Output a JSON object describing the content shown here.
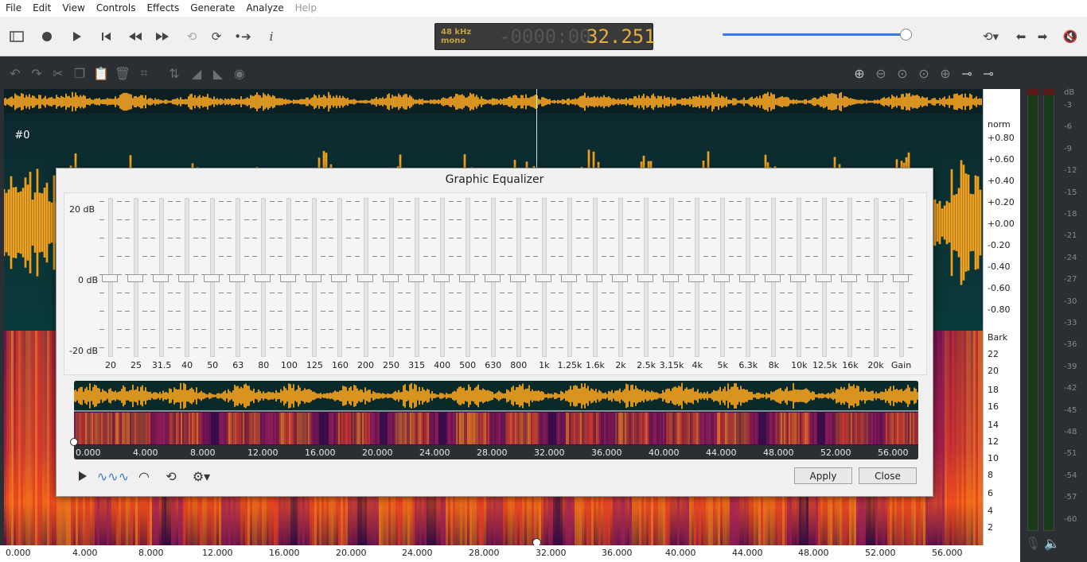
{
  "menu": [
    "File",
    "Edit",
    "View",
    "Controls",
    "Effects",
    "Generate",
    "Analyze",
    "Help"
  ],
  "time_display": {
    "rate": "48 kHz",
    "channels": "mono",
    "dim": "-0000:00",
    "value": "32.251"
  },
  "track": {
    "label": "#0"
  },
  "right_axis": {
    "norm_label": "norm",
    "norm_ticks": [
      "+0.80",
      "+0.60",
      "+0.40",
      "+0.20",
      "+0.00",
      "-0.20",
      "-0.40",
      "-0.60",
      "-0.80"
    ],
    "bark_label": "Bark",
    "bark_ticks": [
      "22",
      "20",
      "18",
      "16",
      "14",
      "12",
      "10",
      "8",
      "6",
      "4",
      "2"
    ]
  },
  "bottom_ruler": [
    "0.000",
    "4.000",
    "8.000",
    "12.000",
    "16.000",
    "20.000",
    "24.000",
    "28.000",
    "32.000",
    "36.000",
    "40.000",
    "44.000",
    "48.000",
    "52.000",
    "56.000"
  ],
  "meters": {
    "unit": "dB",
    "ticks": [
      "-3",
      "-6",
      "-9",
      "-12",
      "-15",
      "-18",
      "-21",
      "-24",
      "-27",
      "-30",
      "-33",
      "-36",
      "-39",
      "-42",
      "-45",
      "-48",
      "-51",
      "-54",
      "-57",
      "-60"
    ]
  },
  "dialog": {
    "title": "Graphic Equalizer",
    "db_labels": [
      "20 dB",
      "0 dB",
      "-20 dB"
    ],
    "bands": [
      "20",
      "25",
      "31.5",
      "40",
      "50",
      "63",
      "80",
      "100",
      "125",
      "160",
      "200",
      "250",
      "315",
      "400",
      "500",
      "630",
      "800",
      "1k",
      "1.25k",
      "1.6k",
      "2k",
      "2.5k",
      "3.15k",
      "4k",
      "5k",
      "6.3k",
      "8k",
      "10k",
      "12.5k",
      "16k",
      "20k",
      "Gain"
    ],
    "mini_ruler": [
      "0.000",
      "4.000",
      "8.000",
      "12.000",
      "16.000",
      "20.000",
      "24.000",
      "28.000",
      "32.000",
      "36.000",
      "40.000",
      "44.000",
      "48.000",
      "52.000",
      "56.000"
    ],
    "apply": "Apply",
    "close": "Close"
  },
  "colors": {
    "waveform": "#f0a020",
    "track_bg": "#0a1d20",
    "accent": "#3a7bd5"
  }
}
